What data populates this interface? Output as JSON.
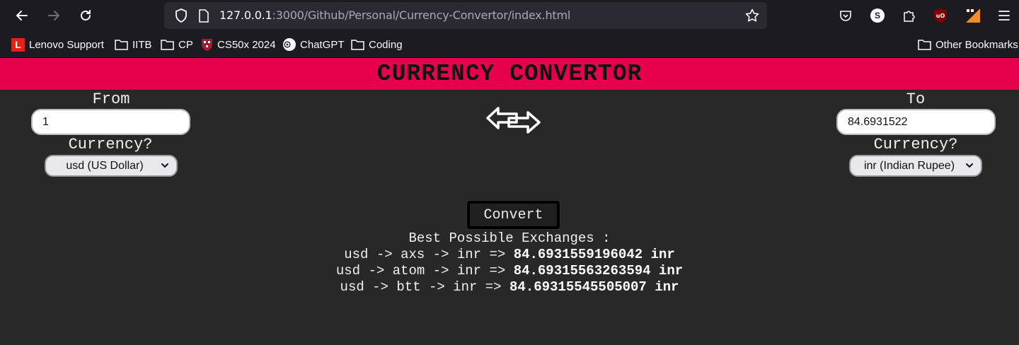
{
  "browser": {
    "url_host": "127.0.0.1",
    "url_path": ":3000/Github/Personal/Currency-Convertor/index.html",
    "bookmarks": [
      {
        "label": "Lenovo Support"
      },
      {
        "label": "IITB"
      },
      {
        "label": "CP"
      },
      {
        "label": "CS50x 2024"
      },
      {
        "label": "ChatGPT"
      },
      {
        "label": "Coding"
      }
    ],
    "other_bookmarks": "Other Bookmarks",
    "account_initial": "S"
  },
  "app": {
    "title": "CURRENCY CONVERTOR",
    "from": {
      "label": "From",
      "amount": "1",
      "currency_label": "Currency?",
      "currency": "usd (US Dollar)"
    },
    "to": {
      "label": "To",
      "amount": "84.6931522",
      "currency_label": "Currency?",
      "currency": "inr (Indian Rupee)"
    },
    "convert_label": "Convert",
    "results_heading": "Best Possible Exchanges :",
    "results": [
      {
        "path": "usd -> axs -> inr => ",
        "value": "84.6931559196042 inr"
      },
      {
        "path": "usd -> atom -> inr => ",
        "value": "84.69315563263594 inr"
      },
      {
        "path": "usd -> btt -> inr => ",
        "value": "84.69315545505007 inr"
      }
    ]
  },
  "colors": {
    "banner": "#e6004c",
    "background": "#282828"
  }
}
